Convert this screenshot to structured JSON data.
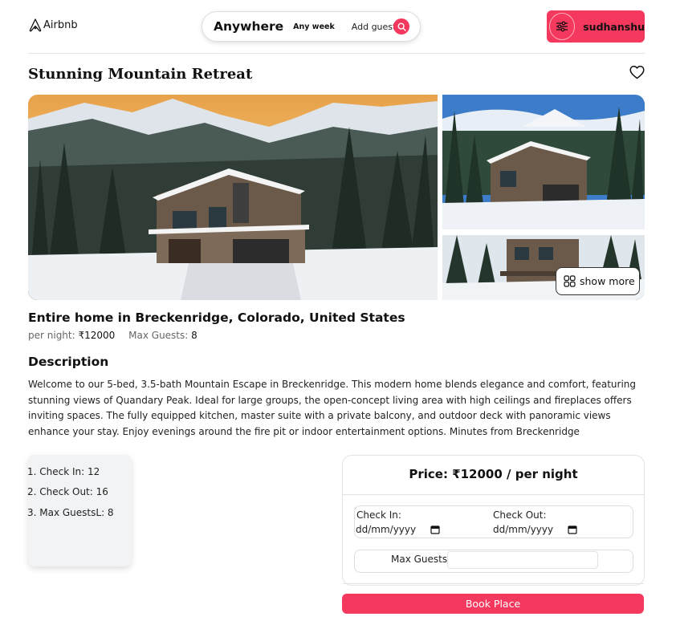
{
  "header": {
    "brand": "Airbnb",
    "search": {
      "location": "Anywhere",
      "week": "Any week",
      "guests": "Add guests"
    },
    "user": "sudhanshu"
  },
  "listing": {
    "title": "Stunning Mountain Retreat",
    "show_more": "show more",
    "subtitle": "Entire home in Breckenridge, Colorado, United States",
    "per_night_label": "per night:",
    "per_night_value": "₹12000",
    "max_guests_label": "Max Guests:",
    "max_guests_value": "8",
    "description_heading": "Description",
    "description": "Welcome to our 5-bed, 3.5-bath Mountain Escape in Breckenridge. This modern home blends elegance and comfort, featuring stunning views of Quandary Peak. Ideal for large groups, the open-concept living area with high ceilings and fireplaces offers inviting spaces. The fully equipped kitchen, master suite with a private balcony, and outdoor deck with panoramic views enhance your stay. Enjoy evenings around the fire pit or indoor entertainment options. Minutes from Breckenridge"
  },
  "info": {
    "items": [
      "1. Check In: 12",
      "2. Check Out: 16",
      "3. Max GuestsL: 8"
    ]
  },
  "booking": {
    "price": "Price: ₹12000 / per night",
    "check_in_label": "Check In:",
    "check_out_label": "Check Out:",
    "date_placeholder": "dd/mm/yyyy",
    "max_guests_label": "Max Guests",
    "book_button": "Book Place"
  },
  "colors": {
    "accent": "#f5385d"
  },
  "icons": [
    "airbnb-logo-icon",
    "search-icon",
    "menu-icon",
    "heart-icon",
    "grid-icon",
    "calendar-icon"
  ]
}
